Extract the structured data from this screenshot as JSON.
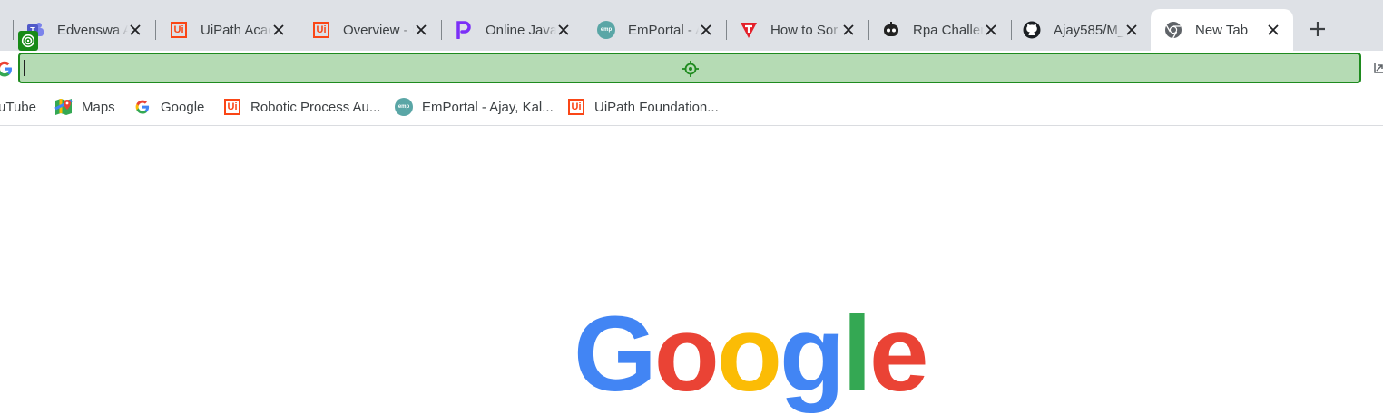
{
  "tabs": [
    {
      "title": "Edvenswa A",
      "icon": "teams-icon"
    },
    {
      "title": "UiPath Acad",
      "icon": "uipath-icon"
    },
    {
      "title": "Overview - U",
      "icon": "uipath-icon"
    },
    {
      "title": "Online Java",
      "icon": "programiz-icon"
    },
    {
      "title": "EmPortal - A",
      "icon": "emportal-icon"
    },
    {
      "title": "How to Sor",
      "icon": "toptal-icon"
    },
    {
      "title": "Rpa Challen",
      "icon": "robot-icon"
    },
    {
      "title": "Ajay585/M_",
      "icon": "github-icon"
    },
    {
      "title": "New Tab",
      "icon": "chrome-icon",
      "active": true
    }
  ],
  "omnibox": {
    "value": ""
  },
  "bookmarks": [
    {
      "label": "uTube",
      "icon": "youtube-icon"
    },
    {
      "label": "Maps",
      "icon": "maps-icon"
    },
    {
      "label": "Google",
      "icon": "google-icon"
    },
    {
      "label": "Robotic Process Au...",
      "icon": "uipath-icon"
    },
    {
      "label": "EmPortal - Ajay, Kal...",
      "icon": "emportal-icon"
    },
    {
      "label": "UiPath Foundation...",
      "icon": "uipath-icon"
    }
  ],
  "logo": {
    "letters": [
      "G",
      "o",
      "o",
      "g",
      "l",
      "e"
    ],
    "colors": [
      "#4285f4",
      "#ea4335",
      "#fbbc05",
      "#4285f4",
      "#34a853",
      "#ea4335"
    ]
  },
  "uipath_icon_text": "Ui",
  "emportal_icon_text": "emp",
  "colors": {
    "highlight_fill": "#b5dbb4",
    "highlight_border": "#1e8a1e",
    "tabstrip": "#dee1e6"
  }
}
